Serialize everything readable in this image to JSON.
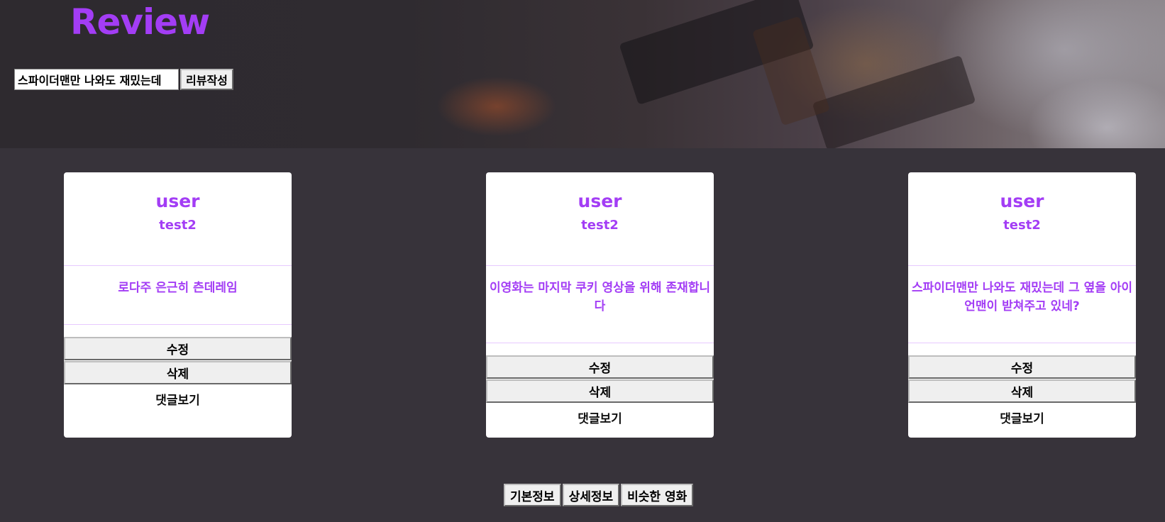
{
  "header": {
    "title": "Review",
    "review_input_value": "스파이더맨만 나와도 재밌는데",
    "submit_label": "리뷰작성"
  },
  "cards": [
    {
      "user": "user",
      "title": "test2",
      "content": "로다주 은근히 츤데레임",
      "edit_label": "수정",
      "delete_label": "삭제",
      "comments_label": "댓글보기"
    },
    {
      "user": "user",
      "title": "test2",
      "content": "이영화는 마지막 쿠키 영상을 위해 존재합니다",
      "edit_label": "수정",
      "delete_label": "삭제",
      "comments_label": "댓글보기"
    },
    {
      "user": "user",
      "title": "test2",
      "content": "스파이더맨만 나와도 재밌는데 그 옆을 아이언맨이 받쳐주고 있네?",
      "edit_label": "수정",
      "delete_label": "삭제",
      "comments_label": "댓글보기"
    }
  ],
  "bottom_nav": {
    "basic_info": "기본정보",
    "detail_info": "상세정보",
    "similar_movies": "비슷한 영화"
  },
  "colors": {
    "accent": "#a33df5",
    "background": "#37333a",
    "card": "#ffffff",
    "divider": "#e7c9ff"
  }
}
